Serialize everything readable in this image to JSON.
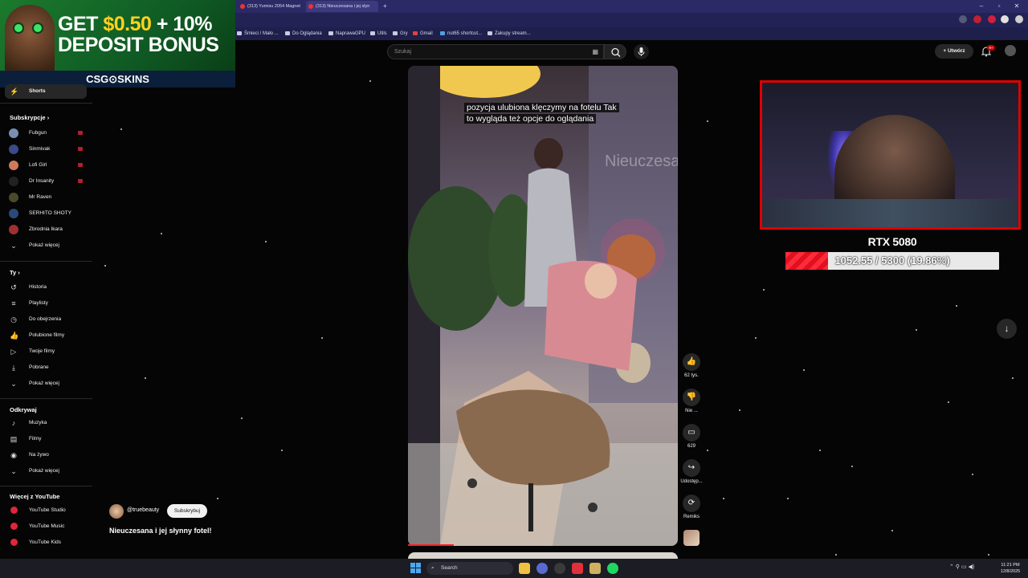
{
  "browser": {
    "tabs": [
      {
        "label": "(313) Yumisu 2054 Magnet"
      },
      {
        "label": "(313) Nieuczesana i jej słyn"
      }
    ],
    "bookmarks": [
      "Śmieci / Mało ...",
      "Do Oglądania",
      "NaprawaGPU",
      "Utils",
      "Gry",
      "Gmail",
      "nut65 shortcut...",
      "Zakupy stream..."
    ],
    "window_controls": {
      "minimize": "–",
      "maximize": "▫",
      "close": "✕"
    }
  },
  "ad": {
    "line1_prefix": "GET ",
    "line1_amount": "$0.50",
    "line1_suffix": " + 10%",
    "line2": "DEPOSIT BONUS",
    "brand": "CSG⊙SKINS"
  },
  "sidebar": {
    "shorts_label": "Shorts",
    "subscriptions_heading": "Subskrypcje",
    "subscriptions": [
      {
        "label": "Fubgun",
        "color": "#7a8fb0",
        "live": true
      },
      {
        "label": "Sinmivak",
        "color": "#3a4a8a",
        "live": true
      },
      {
        "label": "Lofi Girl",
        "color": "#d07a5a",
        "live": true
      },
      {
        "label": "Dr Insanity",
        "color": "#222222",
        "live": true
      },
      {
        "label": "Mr Raven",
        "color": "#4a4a2a",
        "live": false
      },
      {
        "label": "SERHITO SHOTY",
        "color": "#2a4a7a",
        "live": false
      },
      {
        "label": "Zbrodnia Ikara",
        "color": "#a03030",
        "live": false
      },
      {
        "label": "Pokaż więcej",
        "color": "",
        "live": false
      }
    ],
    "you_heading": "Ty",
    "you_items": [
      {
        "label": "Historia",
        "icon": "history-icon",
        "glyph": "↺"
      },
      {
        "label": "Playlisty",
        "icon": "playlists-icon",
        "glyph": "≡"
      },
      {
        "label": "Do obejrzenia",
        "icon": "watch-later-icon",
        "glyph": "◷"
      },
      {
        "label": "Polubione filmy",
        "icon": "liked-icon",
        "glyph": "👍"
      },
      {
        "label": "Twoje filmy",
        "icon": "your-videos-icon",
        "glyph": "▷"
      },
      {
        "label": "Pobrane",
        "icon": "downloads-icon",
        "glyph": "⤓"
      },
      {
        "label": "Pokaż więcej",
        "icon": "chevron-down-icon",
        "glyph": "⌄"
      }
    ],
    "explore_heading": "Odkrywaj",
    "explore_items": [
      {
        "label": "Muzyka",
        "icon": "music-icon",
        "glyph": "♪"
      },
      {
        "label": "Filmy",
        "icon": "movies-icon",
        "glyph": "▤"
      },
      {
        "label": "Na żywo",
        "icon": "live-icon",
        "glyph": "◉"
      },
      {
        "label": "Pokaż więcej",
        "icon": "chevron-down-icon",
        "glyph": "⌄"
      }
    ],
    "more_heading": "Więcej z YouTube",
    "more_items": [
      {
        "label": "YouTube Studio"
      },
      {
        "label": "YouTube Music"
      },
      {
        "label": "YouTube Kids"
      }
    ]
  },
  "header": {
    "search_placeholder": "Szukaj",
    "create_label": "Utwórz",
    "notification_count": "9+"
  },
  "short": {
    "caption_line1": "pozycja ulubiona klęczymy na fotelu Tak",
    "caption_line2": "to wygląda też opcje do oglądania",
    "watermark": "Nieuczesa",
    "progress_fraction": 0.17,
    "channel": "@truebeauty",
    "subscribe_label": "Subskrybuj",
    "title": "Nieuczesana i jej słynny fotel!",
    "actions": [
      {
        "name": "like",
        "glyph": "👍",
        "label": "62 tys."
      },
      {
        "name": "dislike",
        "glyph": "👎",
        "label": "Nie ..."
      },
      {
        "name": "comments",
        "glyph": "▭",
        "label": "629"
      },
      {
        "name": "share",
        "glyph": "↪",
        "label": "Udostęp..."
      },
      {
        "name": "remix",
        "glyph": "⟳",
        "label": "Remiks"
      }
    ]
  },
  "gpu_widget": {
    "title": "RTX 5080",
    "current": 1052.55,
    "target": 5300,
    "progress_text": "1052.55 / 5300 (19.86%)",
    "fraction": 0.1986
  },
  "taskbar": {
    "search_label": "Search",
    "time": "11:21 PM",
    "date": "12/8/2025"
  }
}
